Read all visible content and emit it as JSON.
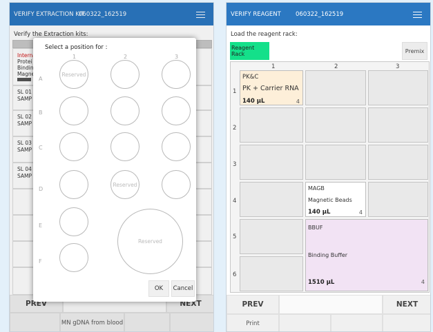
{
  "left_screen": {
    "title": "VERIFY EXTRACTION KIT",
    "run_id": "060322_162519",
    "instruction": "Verify the Extraction kits:",
    "bg_legend": [
      "Interna",
      "Protei",
      "Bindin",
      "Magne"
    ],
    "bg_samples": [
      {
        "line1": "SL 01",
        "line2": "SAMP"
      },
      {
        "line1": "SL 02",
        "line2": "SAMP"
      },
      {
        "line1": "SL 03",
        "line2": "SAMP"
      },
      {
        "line1": "SL 04",
        "line2": "SAMP"
      }
    ],
    "modal": {
      "title": "Select a position for :",
      "columns": [
        "1",
        "2",
        "3"
      ],
      "rows": [
        "A",
        "B",
        "C",
        "D",
        "E",
        "F"
      ],
      "reserved_label": "Reserved",
      "ok_label": "OK",
      "cancel_label": "Cancel"
    },
    "prev_label": "PREV",
    "next_label": "NEXT",
    "kit_label": "MN gDNA from blood"
  },
  "right_screen": {
    "title": "VERIFY REAGENT",
    "run_id": "060322_162519",
    "instruction": "Load the reagent rack:",
    "rack_button": "Reagent Rack",
    "premix_button": "Premix",
    "columns": [
      "1",
      "2",
      "3"
    ],
    "rows": [
      "1",
      "2",
      "3",
      "4",
      "5",
      "6"
    ],
    "reagents": {
      "pkc": {
        "code": "PK&C",
        "name": "PK + Carrier RNA",
        "volume": "140 µL",
        "count": "4",
        "color": "#fdefd9"
      },
      "magb": {
        "code": "MAGB",
        "name": "Magnetic Beads",
        "volume": "140 µL",
        "count": "4",
        "color": "#ffffff"
      },
      "bbuf": {
        "code": "BBUF",
        "name": "Binding Buffer",
        "volume": "1510 µL",
        "count": "4",
        "color": "#f2e3f4"
      }
    },
    "prev_label": "PREV",
    "next_label": "NEXT",
    "print_label": "Print"
  },
  "colors": {
    "titlebar": "#2b78c2",
    "accent_green": "#14e08a"
  }
}
